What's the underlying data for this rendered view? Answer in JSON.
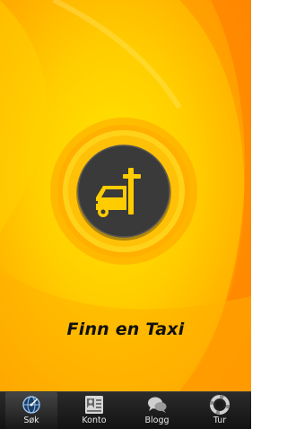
{
  "main": {
    "title": "Finn en Taxi",
    "primary_action_icon": "taxi-icon",
    "accent_color": "#ffc20e",
    "background_color": "#ffb300",
    "button_color": "#3a3a3a"
  },
  "tabs": [
    {
      "label": "Søk",
      "icon": "search-globe-icon",
      "active": true
    },
    {
      "label": "Konto",
      "icon": "account-card-icon",
      "active": false
    },
    {
      "label": "Blogg",
      "icon": "blog-chat-icon",
      "active": false
    },
    {
      "label": "Tur",
      "icon": "trip-lifebuoy-icon",
      "active": false
    }
  ]
}
